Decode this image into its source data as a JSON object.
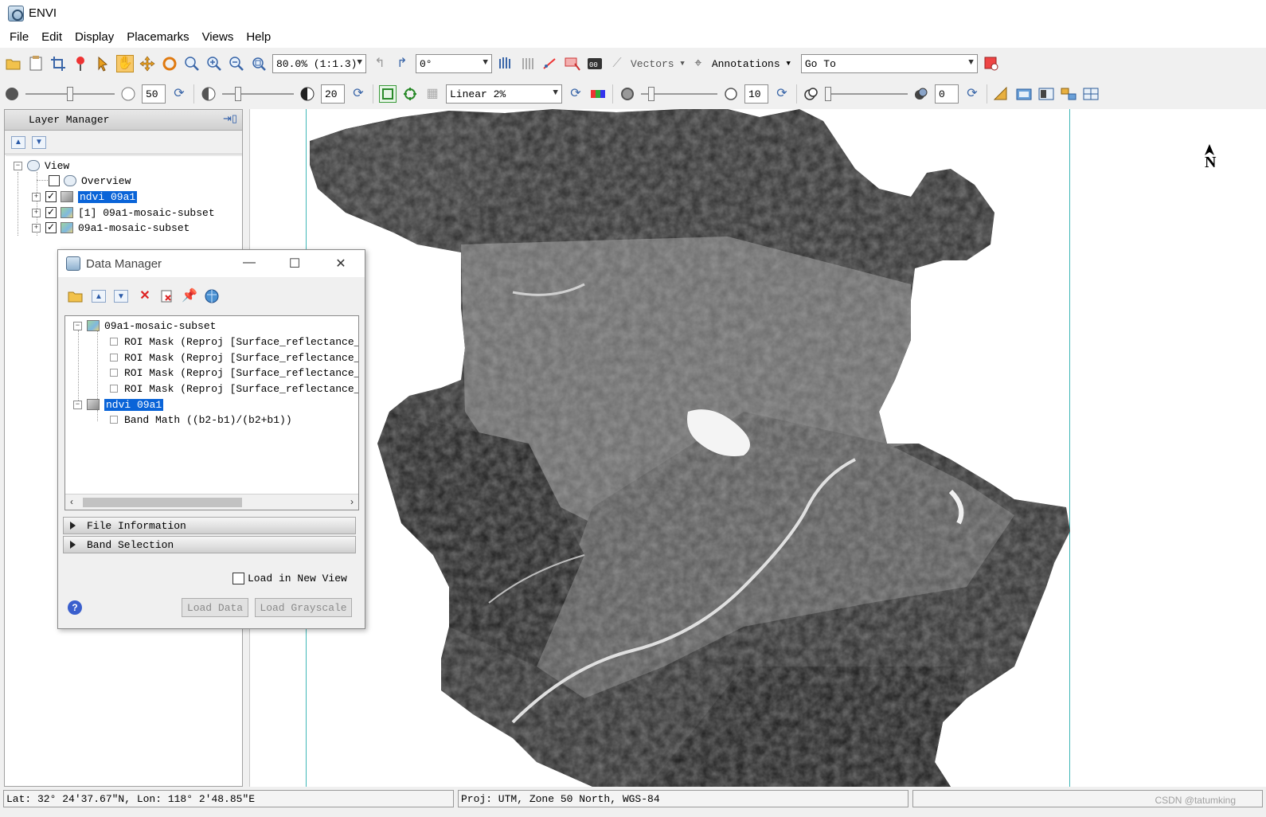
{
  "app": {
    "title": "ENVI"
  },
  "menu": [
    "File",
    "Edit",
    "Display",
    "Placemarks",
    "Views",
    "Help"
  ],
  "toolbar1": {
    "zoom_value": "80.0% (1:1.3)",
    "rotation_value": "0°",
    "vectors_label": "Vectors",
    "annotations_label": "Annotations",
    "goto_value": "Go To"
  },
  "toolbar2": {
    "brightness_value": "50",
    "contrast_value": "20",
    "stretch_value": "Linear 2%",
    "sharpen_value": "10",
    "transparency_value": "0",
    "brightness_level": 0.5,
    "contrast_level": 0.2,
    "sharpen_level": 0.1,
    "transparency_level": 0.0
  },
  "layer_manager": {
    "title": "Layer Manager",
    "tree": [
      {
        "label": "View",
        "level": 0
      },
      {
        "label": "Overview",
        "level": 1,
        "checked": false
      },
      {
        "label": "ndvi 09a1",
        "level": 1,
        "checked": true,
        "selected": true
      },
      {
        "label": "[1] 09a1-mosaic-subset",
        "level": 1,
        "checked": true
      },
      {
        "label": "09a1-mosaic-subset",
        "level": 1,
        "checked": true
      }
    ]
  },
  "data_manager": {
    "title": "Data Manager",
    "tree": [
      {
        "label": "09a1-mosaic-subset",
        "level": 0
      },
      {
        "label": "ROI Mask (Reproj [Surface_reflectance_f",
        "level": 1
      },
      {
        "label": "ROI Mask (Reproj [Surface_reflectance_f",
        "level": 1
      },
      {
        "label": "ROI Mask (Reproj [Surface_reflectance_f",
        "level": 1
      },
      {
        "label": "ROI Mask (Reproj [Surface_reflectance_f",
        "level": 1
      },
      {
        "label": "ndvi 09a1",
        "level": 0,
        "selected": true
      },
      {
        "label": "Band Math ((b2-b1)/(b2+b1))",
        "level": 1
      }
    ],
    "sections": [
      "File Information",
      "Band Selection"
    ],
    "load_new_view_label": "Load in New View",
    "load_data_label": "Load Data",
    "load_grayscale_label": "Load Grayscale"
  },
  "map": {
    "north_label": "N"
  },
  "status": {
    "latlon": "Lat: 32° 24'37.67\"N, Lon: 118° 2'48.85\"E",
    "proj": "Proj: UTM, Zone 50 North, WGS-84"
  },
  "watermark": "CSDN @tatumking"
}
